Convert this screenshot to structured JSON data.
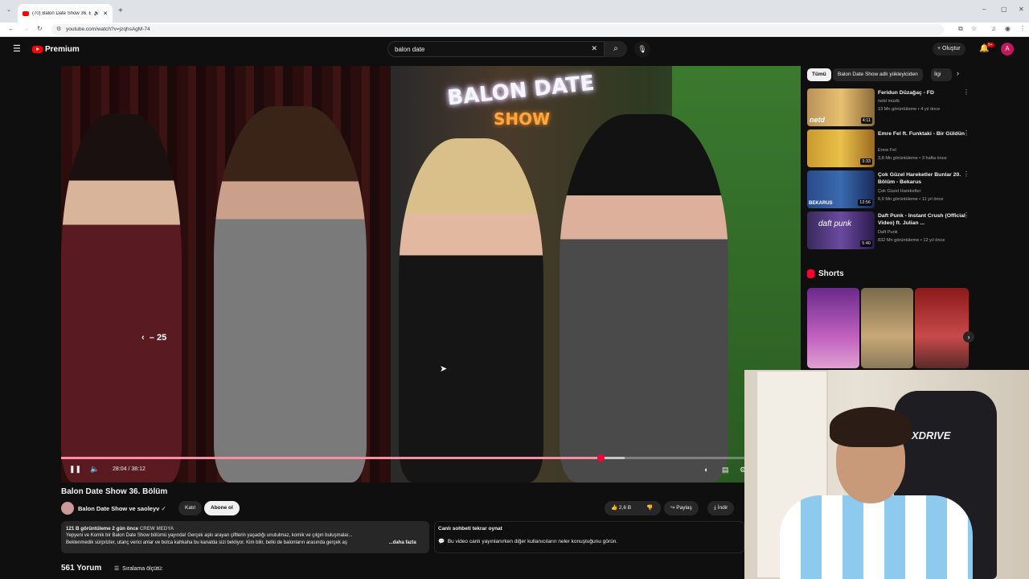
{
  "browser": {
    "tab_title": "(70) Balon Date Show 36. B",
    "url": "youtube.com/watch?v=jzqhsAgM-74"
  },
  "header": {
    "logo_text": "Premium",
    "search_value": "balon date",
    "create_label": "Oluştur",
    "notification_count": "9+",
    "avatar_letter": "A"
  },
  "player": {
    "neon_line1": "BALON DATE",
    "neon_line2": "SHOW",
    "seek_indicator": "25",
    "time_display": "28:04 / 38:12",
    "progress": 0.789,
    "buffered": 0.825
  },
  "video_info": {
    "title": "Balon Date Show 36. Bölüm",
    "channel": "Balon Date Show ve saoleyv",
    "join_label": "Katıl",
    "subscribe_label": "Abone ol",
    "likes": "2,6 B",
    "share_label": "Paylaş",
    "download_label": "İndir",
    "views_date": "121 B görüntüleme  2 gün önce",
    "tag": "CREW MEDYA",
    "desc_line1": "Yepyeni ve Komik bir Balon Date Show bölümü yayında! Gerçek aşkı arayan çiftlerin yaşadığı unutulmaz, komik ve çılgın buluşmalar...",
    "desc_line2": "Beklenmedik sürprizler, utanç verici anlar ve bolca kahkaha bu kanalda sizi bekliyor. Kim bilir, belki de balonların arasında gerçek aş",
    "more_label": "...daha fazla",
    "chat_title": "Canlı sohbeti tekrar oynat",
    "chat_desc": "Bu video canlı yayınlanırken diğer kullanıcıların neler konuştuğunu görün.",
    "comment_count": "561 Yorum",
    "sort_label": "Sıralama ölçütü:"
  },
  "sidebar": {
    "chips": [
      "Tümü",
      "Balon Date Show adlı yükleyiciden",
      "İlgi"
    ],
    "recommendations": [
      {
        "title": "Feridun Düzağaç - FD",
        "channel": "netd müzik",
        "meta": "13 Mn görüntüleme • 4 yıl önce",
        "duration": "4:11",
        "thumb_label": "netd"
      },
      {
        "title": "Emre Fel ft. Funktaki - Bir Güldün",
        "channel": "Emre Fel",
        "meta": "3,8 Mn görüntüleme • 3 hafta önce",
        "duration": "3:33",
        "thumb_label": ""
      },
      {
        "title": "Çok Güzel Hareketler Bunlar 20. Bölüm - Bekarus",
        "channel": "Çok Güzel Hareketler",
        "meta": "6,9 Mn görüntüleme • 11 yıl önce",
        "duration": "13:56",
        "thumb_label": "BEKARUS"
      },
      {
        "title": "Daft Punk - Instant Crush (Official Video) ft. Julian ...",
        "channel": "Daft Punk",
        "meta": "832 Mn görüntüleme • 12 yıl önce",
        "duration": "5:40",
        "thumb_label": "daft punk"
      }
    ],
    "shorts_title": "Shorts"
  },
  "webcam": {
    "chair_brand": "XDRIVE"
  },
  "colors": {
    "accent": "#ff0033",
    "background": "#0f0f0f",
    "chip_bg": "#272727"
  }
}
